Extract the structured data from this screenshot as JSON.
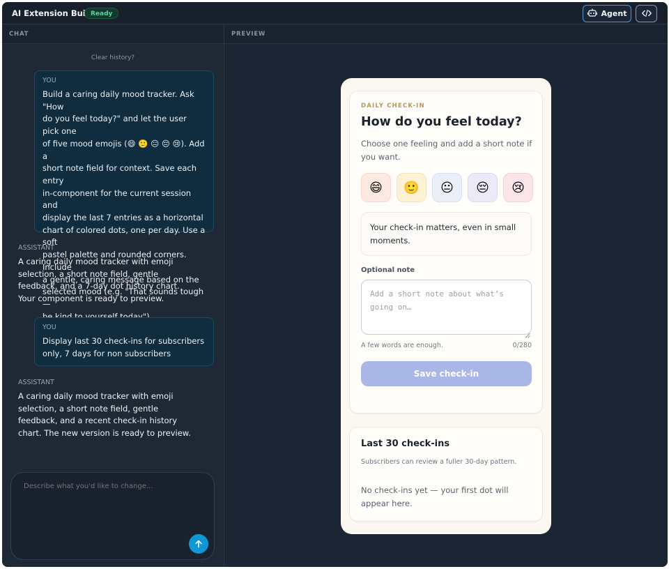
{
  "app": {
    "title": "AI Extension Builder",
    "status": "Ready"
  },
  "toolbar": {
    "agent_label": "Agent",
    "code_icon": "code-icon"
  },
  "sections": {
    "chat": "CHAT",
    "preview": "PREVIEW"
  },
  "chat": {
    "clear_history": "Clear history?",
    "messages": [
      {
        "role": "YOU",
        "text": "Build a caring daily mood tracker. Ask \"How\ndo you feel today?\" and let the user pick one\nof five mood emojis (😄 🙂 😐 😔 😢). Add a\nshort note field for context. Save each entry\nin-component for the current session and\ndisplay the last 7 entries as a horizontal\nchart of colored dots, one per day. Use a soft\npastel palette and rounded corners. Include\na gentle, caring message based on the\nselected mood (e.g. \"That sounds tough —\nbe kind to yourself today\")."
      },
      {
        "role": "ASSISTANT",
        "text": "A caring daily mood tracker with emoji\nselection, a short note field, gentle\nfeedback, and a 7-day dot history chart.\nYour component is ready to preview."
      },
      {
        "role": "YOU",
        "text": "Display last 30 check-ins for subscribers\nonly, 7 days for non subscribers"
      },
      {
        "role": "ASSISTANT",
        "text": "A caring daily mood tracker with emoji\nselection, a short note field, gentle\nfeedback, and a recent check-in history\nchart. The new version is ready to preview."
      }
    ],
    "composer_placeholder": "Describe what you'd like to change..."
  },
  "preview": {
    "eyebrow": "DAILY CHECK-IN",
    "question": "How do you feel today?",
    "subtitle": "Choose one feeling and add a short note if you want.",
    "moods": [
      {
        "emoji": "😄",
        "bg": "#fde9e1",
        "border": "#f6d6c9"
      },
      {
        "emoji": "🙂",
        "bg": "#fdf3d4",
        "border": "#f3e3b4"
      },
      {
        "emoji": "😐",
        "bg": "#e9eef7",
        "border": "#d6dfee"
      },
      {
        "emoji": "😔",
        "bg": "#ece9f8",
        "border": "#dcd6f1"
      },
      {
        "emoji": "😢",
        "bg": "#fce5ea",
        "border": "#f4cfd7"
      }
    ],
    "message": "Your check-in matters, even in small moments.",
    "note_label": "Optional note",
    "note_placeholder": "Add a short note about what’s going on…",
    "helper": "A few words are enough.",
    "counter": "0/280",
    "save_label": "Save check-in",
    "history_title": "Last 30 check-ins",
    "history_subtitle": "Subscribers can review a fuller 30-day pattern.",
    "history_empty": "No check-ins yet — your first dot will appear here."
  },
  "colors": {
    "accent": "#1196d6",
    "ready_badge": "#4fd69c",
    "save_button": "#a8b7e5",
    "eyebrow": "#b5975c"
  }
}
